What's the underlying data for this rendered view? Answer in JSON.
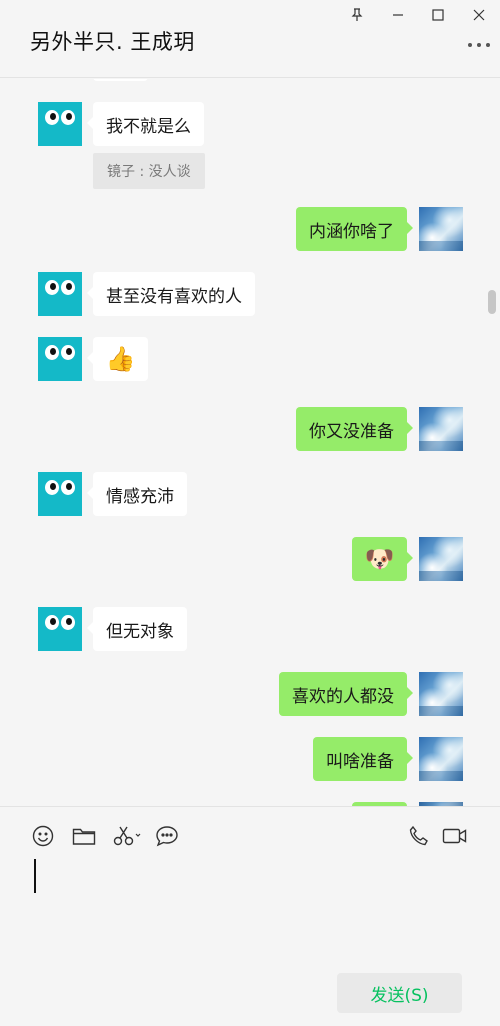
{
  "window": {
    "title": "另外半只. 王成玥",
    "controls": [
      "pin-icon",
      "minimize-icon",
      "maximize-icon",
      "close-icon"
    ],
    "more_icon": "more-dots-icon"
  },
  "messages": [
    {
      "side": "left",
      "text": "我不就是么",
      "quote": "镜子 : 没人谈"
    },
    {
      "side": "right",
      "text": "内涵你啥了"
    },
    {
      "side": "left",
      "text": "甚至没有喜欢的人"
    },
    {
      "side": "left",
      "emoji": "👍",
      "emoji_name": "thumbs-up-icon"
    },
    {
      "side": "right",
      "text": "你又没准备"
    },
    {
      "side": "left",
      "text": "情感充沛"
    },
    {
      "side": "right",
      "emoji": "🐶",
      "emoji_name": "doge-emoji-icon"
    },
    {
      "side": "left",
      "text": "但无对象"
    },
    {
      "side": "right",
      "text": "喜欢的人都没"
    },
    {
      "side": "right",
      "text": "叫啥准备"
    }
  ],
  "toolbar": {
    "left": [
      "emoji-icon",
      "folder-icon",
      "scissors-icon",
      "chat-bubble-icon"
    ],
    "right": [
      "phone-icon",
      "video-call-icon"
    ]
  },
  "input": {
    "value": ""
  },
  "send_button": {
    "label": "发送(S)"
  },
  "colors": {
    "self_bubble": "#95ec69",
    "other_bubble": "#ffffff",
    "background": "#f5f5f5",
    "send_text": "#07c160",
    "avatar_teal": "#14b9c8"
  }
}
